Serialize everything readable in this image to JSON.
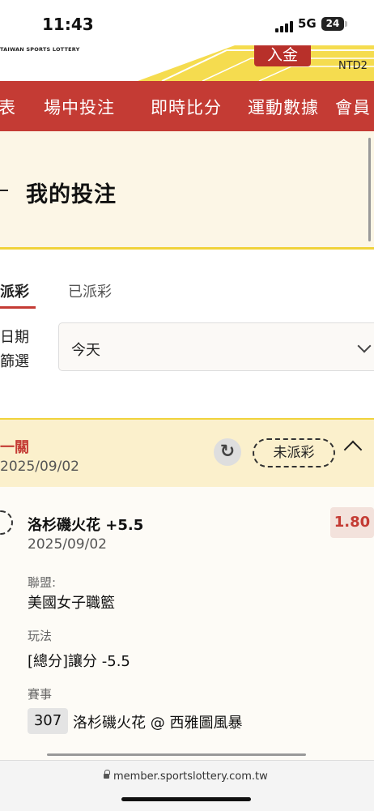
{
  "status_bar": {
    "time": "11:43",
    "network": "5G",
    "battery": "24"
  },
  "header": {
    "brand_sub": "TAIWAN SPORTS LOTTERY",
    "deposit_label": "入金",
    "currency": "NTD2",
    "accent_yellow": "#f0d33c",
    "accent_red": "#c43b34"
  },
  "nav": {
    "items": [
      "表",
      "場中投注",
      "即時比分",
      "運動數據",
      "會員"
    ]
  },
  "page": {
    "title": "我的投注"
  },
  "tabs": {
    "active": "派彩",
    "inactive": "已派彩"
  },
  "filter": {
    "label_line1": "日期",
    "label_line2": "篩選",
    "value": "今天"
  },
  "bet": {
    "type": "一關",
    "date": "2025/09/02",
    "status": "未派彩",
    "selection": "洛杉磯火花 +5.5",
    "selection_date": "2025/09/02",
    "odds": "1.80",
    "league_label": "聯盟:",
    "league": "美國女子職籃",
    "market_label": "玩法",
    "market": "[總分]讓分 -5.5",
    "event_label": "賽事",
    "event_code": "307",
    "event_name": "洛杉磯火花 @ 西雅圖風暴"
  },
  "browser": {
    "url": "member.sportslottery.com.tw"
  },
  "icons": {
    "refresh": "refresh-icon",
    "collapse": "chevron-up-icon",
    "dropdown": "chevron-down-icon",
    "lock": "lock-icon"
  }
}
